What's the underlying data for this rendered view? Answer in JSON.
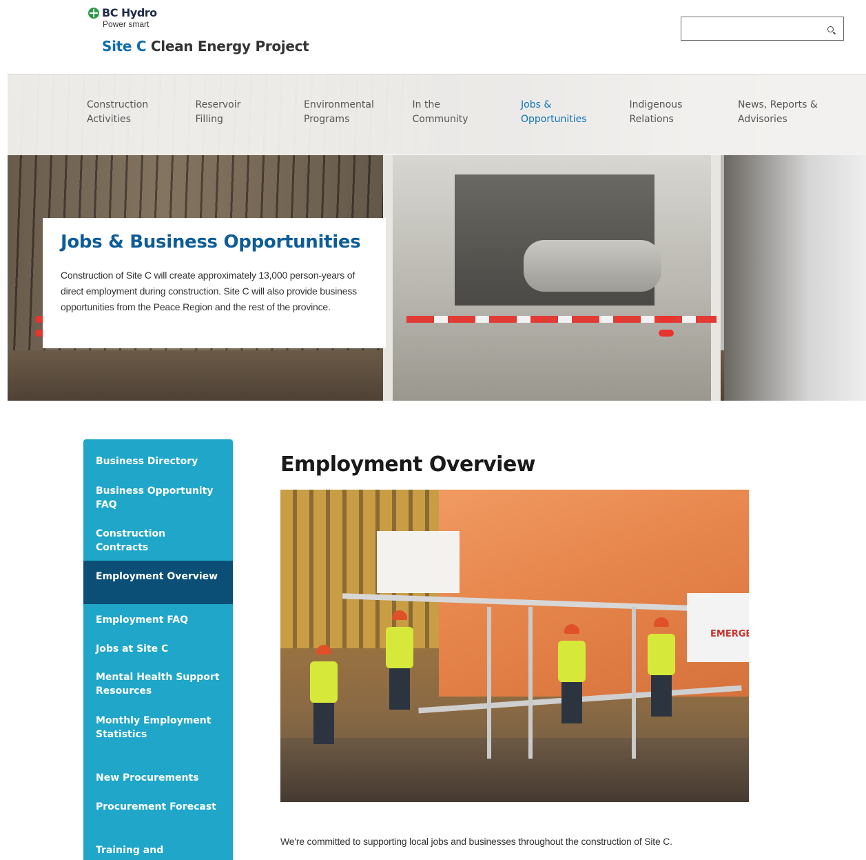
{
  "brand": {
    "name": "BC Hydro",
    "tagline": "Power smart",
    "project_accent": "Site C",
    "project_rest": "Clean Energy Project"
  },
  "search": {
    "placeholder": ""
  },
  "nav": {
    "items": [
      {
        "line1": "Construction",
        "line2": "Activities"
      },
      {
        "line1": "Reservoir",
        "line2": "Filling"
      },
      {
        "line1": "Environmental",
        "line2": "Programs"
      },
      {
        "line1": "In the",
        "line2": "Community"
      },
      {
        "line1": "Jobs &",
        "line2": "Opportunities"
      },
      {
        "line1": "Indigenous",
        "line2": "Relations"
      },
      {
        "line1": "News, Reports &",
        "line2": "Advisories"
      }
    ],
    "active_index": 4
  },
  "hero": {
    "title": "Jobs & Business Opportunities",
    "body": "Construction of Site C will create approximately 13,000 person-years of direct employment during construction. Site C will also provide business opportunities from the Peace Region and the rest of the province."
  },
  "sidebar": {
    "items": [
      {
        "label": "Business Directory"
      },
      {
        "label": "Business Opportunity FAQ"
      },
      {
        "label": "Construction Contracts"
      },
      {
        "label": "Employment Overview"
      },
      {
        "label": "Employment FAQ"
      },
      {
        "label": "Jobs at Site C"
      },
      {
        "label": "Mental Health Support Resources"
      },
      {
        "label": "Monthly Employment Statistics"
      },
      {
        "label": "New Procurements"
      },
      {
        "label": "Procurement Forecast"
      },
      {
        "label": "Training and"
      }
    ],
    "active_index": 3
  },
  "main": {
    "title": "Employment Overview",
    "photo_sign_text": "EMERGE",
    "intro": "We're committed to supporting local jobs and businesses throughout the construction of Site C."
  },
  "colors": {
    "brand_green": "#2e9a47",
    "accent_blue": "#0f6cae",
    "sidebar_teal": "#1fa6c9",
    "sidebar_active": "#0b4f76"
  }
}
